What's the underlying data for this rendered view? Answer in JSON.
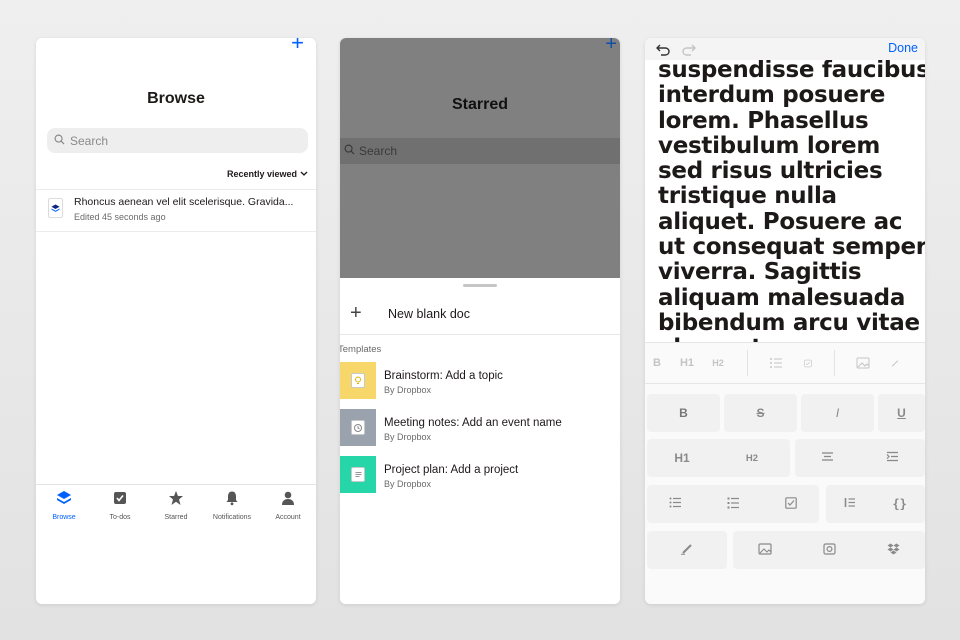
{
  "browse_screen": {
    "title": "Browse",
    "search_placeholder": "Search",
    "sort_label": "Recently viewed",
    "files": [
      {
        "name": "Rhoncus aenean vel elit scelerisque. Gravida...",
        "meta": "Edited 45 seconds ago"
      }
    ],
    "tabs": [
      {
        "label": "Browse",
        "icon": "layers-icon",
        "active": true
      },
      {
        "label": "To-dos",
        "icon": "checkbox-icon",
        "active": false
      },
      {
        "label": "Starred",
        "icon": "star-icon",
        "active": false
      },
      {
        "label": "Notifications",
        "icon": "bell-icon",
        "active": false
      },
      {
        "label": "Account",
        "icon": "person-icon",
        "active": false
      }
    ],
    "accent_color": "#0061fe"
  },
  "starred_screen": {
    "title": "Starred",
    "search_placeholder": "Search",
    "new_doc_label": "New blank doc",
    "templates_heading": "Templates",
    "templates": [
      {
        "title": "Brainstorm: Add a topic",
        "author": "By Dropbox",
        "color": "#f7d769",
        "icon": "lightbulb-icon"
      },
      {
        "title": "Meeting notes: Add an event name",
        "author": "By Dropbox",
        "color": "#9aa3ad",
        "icon": "clock-icon"
      },
      {
        "title": "Project plan: Add a project",
        "author": "By Dropbox",
        "color": "#27d6a8",
        "icon": "document-icon"
      }
    ]
  },
  "editor_screen": {
    "done_label": "Done",
    "body_text": "suspendisse faucibus\ninterdum posuere\nlorem. Phasellus\nvestibulum lorem\nsed risus ultricies\ntristique nulla\naliquet. Posuere ac\nut consequat semper\nviverra. Sagittis\naliquam malesuada\nbibendum arcu vitae\nelementum",
    "format_bar": [
      "B",
      "H1",
      "H2"
    ],
    "keyboard": {
      "row1": [
        "B",
        "S",
        "I",
        "U"
      ],
      "row2": [
        "H1",
        "H2"
      ]
    }
  }
}
